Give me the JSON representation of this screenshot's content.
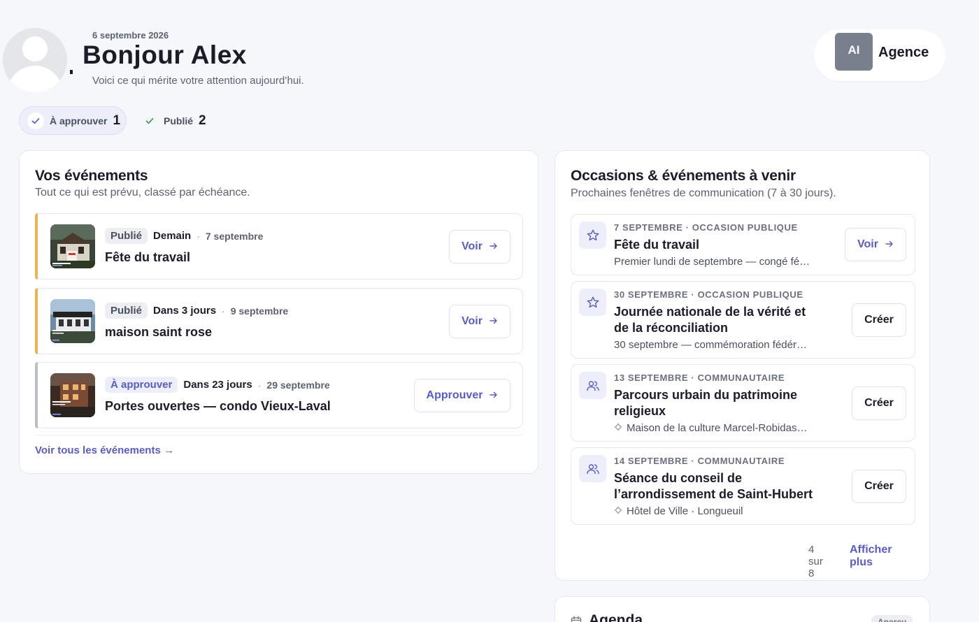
{
  "header": {
    "date": "6 septembre 2026",
    "greeting": "Bonjour Alex",
    "subtitle": "Voici ce qui mérite votre attention aujourd’hui.",
    "agency_initials": "AI",
    "agency_name": "Agence"
  },
  "filters": [
    {
      "label": "À approuver",
      "count": "1"
    },
    {
      "label": "Publié",
      "count": "2"
    }
  ],
  "events_card": {
    "title": "Vos événements",
    "subtitle": "Tout ce qui est prévu, classé par échéance.",
    "see_all": "Voir tous les événements →",
    "items": [
      {
        "status": "Publié",
        "when": "Demain",
        "date": "7 septembre",
        "name": "Fête du travail",
        "action": "Voir",
        "accent": "#f0b24a"
      },
      {
        "status": "Publié",
        "when": "Dans 3 jours",
        "date": "9 septembre",
        "name": "maison saint rose",
        "action": "Voir",
        "accent": "#f0b24a"
      },
      {
        "status": "À approuver",
        "when": "Dans 23 jours",
        "date": "29 septembre",
        "name": "Portes ouvertes — condo Vieux-Laval",
        "action": "Approuver",
        "accent": "#b8bccb"
      }
    ]
  },
  "occasions_card": {
    "title": "Occasions & événements à venir",
    "subtitle": "Prochaines fenêtres de communication (7 à 30 jours).",
    "items": [
      {
        "icon": "star-icon",
        "date": "7 SEPTEMBRE",
        "category": "OCCASION PUBLIQUE",
        "title": "Fête du travail",
        "desc": "Premier lundi de septembre — congé fé…",
        "action": "Voir"
      },
      {
        "icon": "star-icon",
        "date": "30 SEPTEMBRE",
        "category": "OCCASION PUBLIQUE",
        "title": "Journée nationale de la vérité et de la réconciliation",
        "desc": "30 septembre — commémoration fédér…",
        "action": "Créer"
      },
      {
        "icon": "users-icon",
        "date": "13 SEPTEMBRE",
        "category": "COMMUNAUTAIRE",
        "title": "Parcours urbain du patrimoine religieux",
        "desc": "Maison de la culture Marcel-Robidas…",
        "action": "Créer"
      },
      {
        "icon": "users-icon",
        "date": "14 SEPTEMBRE",
        "category": "COMMUNAUTAIRE",
        "title": "Séance du conseil de l’arrondissement de Saint-Hubert",
        "desc": "Hôtel de Ville · Longueuil",
        "action": "Créer"
      }
    ],
    "pager_count": "4 sur 8",
    "show_more": "Afficher plus"
  },
  "agenda_card": {
    "title": "Agenda",
    "badge": "Aperçu"
  },
  "colors": {
    "accent": "#5a5cc5",
    "published_bar": "#f0b24a",
    "pending_bar": "#b8bccb"
  }
}
